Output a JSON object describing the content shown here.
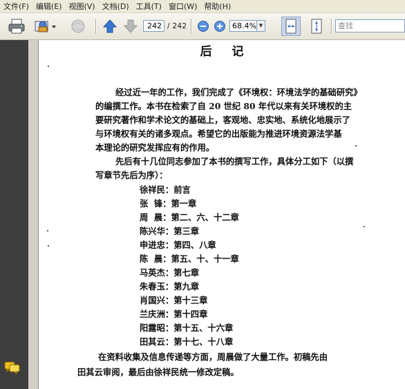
{
  "menu": [
    "文件(F)",
    "编辑(E)",
    "视图(V)",
    "文档(D)",
    "工具(T)",
    "窗口(W)",
    "帮助(H)"
  ],
  "toolbar": {
    "page_current": "242",
    "page_total": "/ 242",
    "zoom": "68.4%",
    "search_placeholder": "查找"
  },
  "document": {
    "title": "后    记",
    "paragraph1": [
      "经过近一年的工作，我们完成了《环境权：环境法学的基础研究》",
      "的编撰工作。本书在检索了自 20 世纪 80 年代以来有关环境权的主",
      "要研究著作和学术论文的基础上，客观地、忠实地、系统化地展示了",
      "与环境权有关的诸多观点。希望它的出版能为推进环境资源法学基",
      "本理论的研究发挥应有的作用。"
    ],
    "paragraph2": [
      "先后有十几位同志参加了本书的撰写工作，具体分工如下（以撰",
      "写章节先后为序）："
    ],
    "assignments": [
      "徐祥民：前言",
      "张  锋：第一章",
      "周  晨：第二、六、十二章",
      "陈兴华：第三章",
      "申进忠：第四、八章",
      "陈  晨：第五、十、十一章",
      "马英杰：第七章",
      "朱春玉：第九章",
      "肖国兴：第十三章",
      "兰庆洲：第十四章",
      "阳露昭：第十五、十六章",
      "田其云：第十七、十八章"
    ],
    "paragraph3": [
      "在资料收集及信息传递等方面，周晨做了大量工作。初稿先由",
      "田其云审阅，最后由徐祥民统一修改定稿。"
    ]
  }
}
